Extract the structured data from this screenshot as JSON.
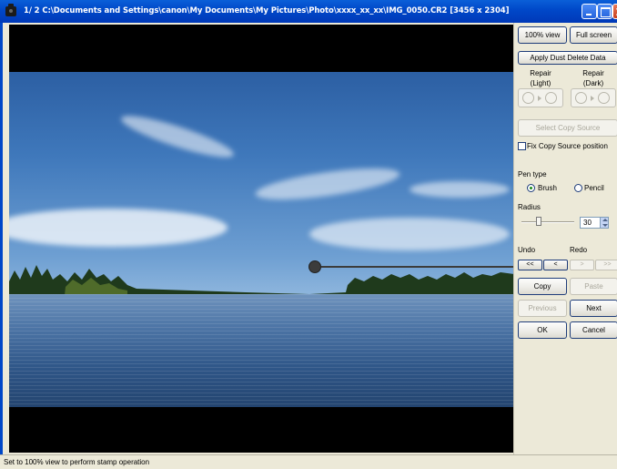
{
  "window": {
    "title": "1/ 2  C:\\Documents and Settings\\canon\\My Documents\\My Pictures\\Photo\\xxxx_xx_xx\\IMG_0050.CR2 [3456 x 2304]"
  },
  "view_buttons": {
    "full_view": "100% view",
    "full_screen": "Full screen"
  },
  "dust_delete": {
    "apply_label": "Apply Dust Delete Data",
    "repair_light": "Repair\n(Light)",
    "repair_light_line1": "Repair",
    "repair_light_line2": "(Light)",
    "repair_dark_line1": "Repair",
    "repair_dark_line2": "(Dark)"
  },
  "copy_source": {
    "select_label": "Select Copy Source",
    "fix_position_label": "Fix Copy Source position",
    "fix_position_checked": false
  },
  "pen": {
    "type_label": "Pen type",
    "options": [
      "Brush",
      "Pencil"
    ],
    "selected": "Brush",
    "radius_label": "Radius",
    "radius_value": "30"
  },
  "history": {
    "undo_label": "Undo",
    "redo_label": "Redo",
    "undo_all": "<<",
    "undo_one": "<",
    "redo_one": ">",
    "redo_all": ">>"
  },
  "actions": {
    "copy": "Copy",
    "paste": "Paste",
    "previous": "Previous",
    "next": "Next",
    "ok": "OK",
    "cancel": "Cancel"
  },
  "status": {
    "text": "Set to 100% view to perform stamp operation"
  },
  "colors": {
    "titlebar": "#0047c8",
    "panel_bg": "#ece9d8",
    "button_border": "#1f3d7a"
  }
}
